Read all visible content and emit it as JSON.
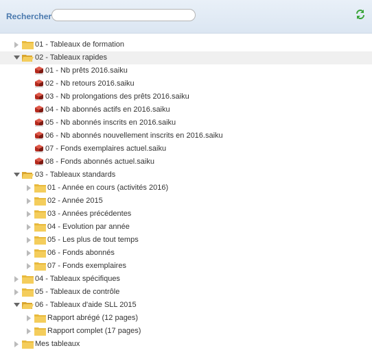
{
  "search": {
    "label": "Rechercher :",
    "value": ""
  },
  "tree": [
    {
      "type": "folder",
      "level": 0,
      "open": false,
      "label": "01 - Tableaux de formation"
    },
    {
      "type": "folder",
      "level": 0,
      "open": true,
      "selected": true,
      "label": "02 - Tableaux rapides"
    },
    {
      "type": "report",
      "level": 1,
      "label": "01 - Nb prêts 2016.saiku"
    },
    {
      "type": "report",
      "level": 1,
      "label": "02 - Nb retours 2016.saiku"
    },
    {
      "type": "report",
      "level": 1,
      "label": "03 - Nb prolongations des prêts 2016.saiku"
    },
    {
      "type": "report",
      "level": 1,
      "label": "04 - Nb abonnés actifs en 2016.saiku"
    },
    {
      "type": "report",
      "level": 1,
      "label": "05 - Nb abonnés inscrits en 2016.saiku"
    },
    {
      "type": "report",
      "level": 1,
      "label": "06 - Nb abonnés nouvellement inscrits en 2016.saiku"
    },
    {
      "type": "report",
      "level": 1,
      "label": "07 - Fonds exemplaires actuel.saiku"
    },
    {
      "type": "report",
      "level": 1,
      "label": "08 - Fonds abonnés actuel.saiku"
    },
    {
      "type": "folder",
      "level": 0,
      "open": true,
      "label": "03 - Tableaux standards"
    },
    {
      "type": "folder",
      "level": 1,
      "open": false,
      "label": "01 - Année en cours (activités 2016)"
    },
    {
      "type": "folder",
      "level": 1,
      "open": false,
      "label": "02 - Année 2015"
    },
    {
      "type": "folder",
      "level": 1,
      "open": false,
      "label": "03 - Années précédentes"
    },
    {
      "type": "folder",
      "level": 1,
      "open": false,
      "label": "04 - Evolution par année"
    },
    {
      "type": "folder",
      "level": 1,
      "open": false,
      "label": "05 - Les plus de tout temps"
    },
    {
      "type": "folder",
      "level": 1,
      "open": false,
      "label": "06 - Fonds abonnés"
    },
    {
      "type": "folder",
      "level": 1,
      "open": false,
      "label": "07 - Fonds exemplaires"
    },
    {
      "type": "folder",
      "level": 0,
      "open": false,
      "label": "04 - Tableaux spécifiques"
    },
    {
      "type": "folder",
      "level": 0,
      "open": false,
      "label": "05 - Tableaux de contrôle"
    },
    {
      "type": "folder",
      "level": 0,
      "open": true,
      "label": "06 - Tableaux d'aide SLL 2015"
    },
    {
      "type": "folder",
      "level": 1,
      "open": false,
      "label": "Rapport abrégé (12 pages)"
    },
    {
      "type": "folder",
      "level": 1,
      "open": false,
      "label": "Rapport complet (17 pages)"
    },
    {
      "type": "folder",
      "level": 0,
      "open": false,
      "label": "Mes tableaux"
    }
  ],
  "icons": {
    "refresh": "refresh-icon",
    "folder": "folder-icon",
    "report": "saiku-report-icon",
    "expand": "triangle-right-icon",
    "collapse": "triangle-down-icon"
  },
  "colors": {
    "label": "#4a79ae",
    "folder": "#f2c94c",
    "report": "#c0392b",
    "refresh": "#3aa53a"
  }
}
